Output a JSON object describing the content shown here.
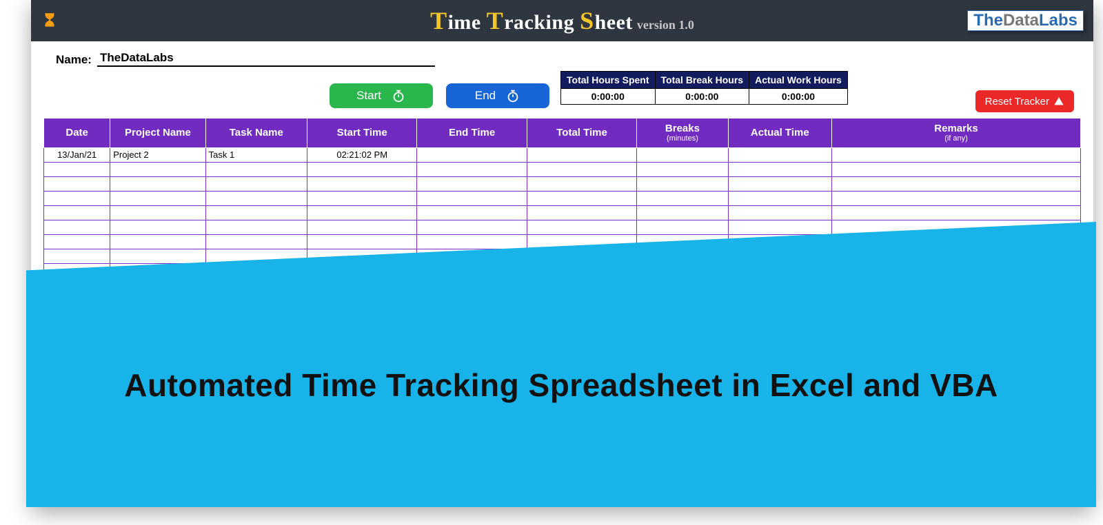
{
  "header": {
    "title_parts": {
      "t1_big": "T",
      "t1_rest": "ime ",
      "t2_big": "T",
      "t2_rest": "racking ",
      "t3_big": "S",
      "t3_rest": "heet"
    },
    "version": "version 1.0",
    "logo": {
      "a": "The",
      "b": "Data",
      "c": "Labs"
    }
  },
  "name": {
    "label": "Name:",
    "value": "TheDataLabs"
  },
  "buttons": {
    "start": "Start",
    "end": "End",
    "reset": "Reset Tracker"
  },
  "summary": {
    "headers": [
      "Total Hours Spent",
      "Total Break Hours",
      "Actual Work Hours"
    ],
    "values": [
      "0:00:00",
      "0:00:00",
      "0:00:00"
    ]
  },
  "grid": {
    "columns": [
      {
        "label": "Date"
      },
      {
        "label": "Project Name"
      },
      {
        "label": "Task Name"
      },
      {
        "label": "Start Time"
      },
      {
        "label": "End Time"
      },
      {
        "label": "Total Time"
      },
      {
        "label": "Breaks",
        "sub": "(minutes)"
      },
      {
        "label": "Actual Time"
      },
      {
        "label": "Remarks",
        "sub": "(if any)"
      }
    ],
    "rows": [
      {
        "date": "13/Jan/21",
        "project": "Project 2",
        "task": "Task 1",
        "start": "02:21:02 PM",
        "end": "",
        "total": "",
        "breaks": "",
        "actual": "",
        "remarks": ""
      }
    ],
    "empty_rows": 9
  },
  "banner": {
    "text": "Automated Time Tracking Spreadsheet in Excel and VBA"
  }
}
